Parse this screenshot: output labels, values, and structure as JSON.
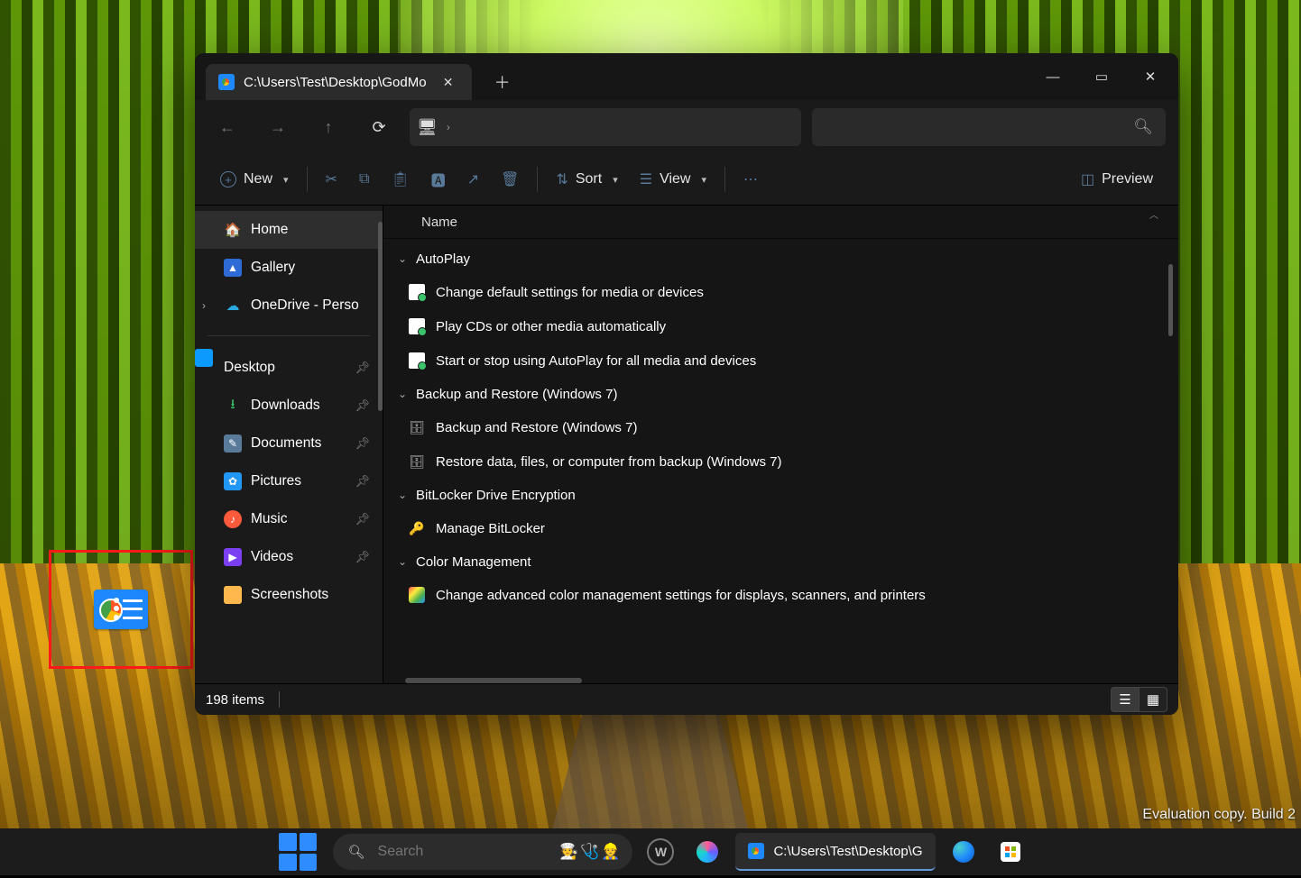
{
  "watermark": "Evaluation copy. Build 2",
  "window": {
    "tab_title": "C:\\Users\\Test\\Desktop\\GodMo",
    "controls": {
      "minimize": "—",
      "maximize": "▭",
      "close": "✕"
    }
  },
  "toolbar": {
    "new_label": "New",
    "sort_label": "Sort",
    "view_label": "View",
    "preview_label": "Preview"
  },
  "column_header": "Name",
  "sidebar": {
    "top": [
      {
        "label": "Home",
        "icon": "home",
        "active": true
      },
      {
        "label": "Gallery",
        "icon": "gallery"
      },
      {
        "label": "OneDrive - Perso",
        "icon": "onedrive",
        "expandable": true
      }
    ],
    "pinned": [
      {
        "label": "Desktop",
        "icon": "desktop",
        "pinned": true
      },
      {
        "label": "Downloads",
        "icon": "downloads",
        "pinned": true
      },
      {
        "label": "Documents",
        "icon": "documents",
        "pinned": true
      },
      {
        "label": "Pictures",
        "icon": "pictures",
        "pinned": true
      },
      {
        "label": "Music",
        "icon": "music",
        "pinned": true
      },
      {
        "label": "Videos",
        "icon": "videos",
        "pinned": true
      },
      {
        "label": "Screenshots",
        "icon": "folder"
      }
    ]
  },
  "groups": [
    {
      "name": "AutoPlay",
      "items": [
        {
          "icon": "cp",
          "label": "Change default settings for media or devices"
        },
        {
          "icon": "cp",
          "label": "Play CDs or other media automatically"
        },
        {
          "icon": "cp",
          "label": "Start or stop using AutoPlay for all media and devices"
        }
      ]
    },
    {
      "name": "Backup and Restore (Windows 7)",
      "items": [
        {
          "icon": "bk",
          "label": "Backup and Restore (Windows 7)"
        },
        {
          "icon": "bk",
          "label": "Restore data, files, or computer from backup (Windows 7)"
        }
      ]
    },
    {
      "name": "BitLocker Drive Encryption",
      "items": [
        {
          "icon": "lock",
          "label": "Manage BitLocker"
        }
      ]
    },
    {
      "name": "Color Management",
      "items": [
        {
          "icon": "cm",
          "label": "Change advanced color management settings for displays, scanners, and printers"
        }
      ]
    }
  ],
  "status": {
    "count": "198 items"
  },
  "taskbar": {
    "search_placeholder": "Search",
    "active_task": "C:\\Users\\Test\\Desktop\\G"
  }
}
